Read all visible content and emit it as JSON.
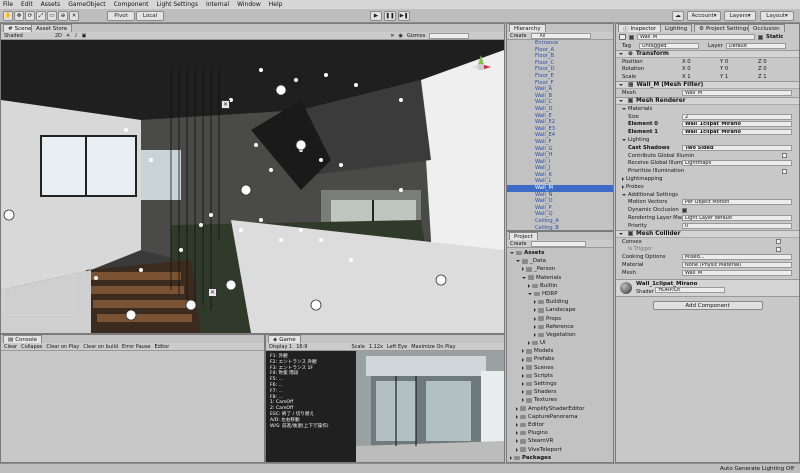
{
  "menu": [
    "File",
    "Edit",
    "Assets",
    "GameObject",
    "Component",
    "Light Settings",
    "Internal",
    "Window",
    "Help"
  ],
  "toolbar": {
    "pivot": "Pivot",
    "local": "Local",
    "account": "Account",
    "layers": "Layers",
    "layout": "Layout"
  },
  "scene": {
    "tab_scene": "Scene",
    "tab_asset_store": "Asset Store",
    "shaded": "Shaded",
    "mode_2d": "2D",
    "gizmos": "Gizmos"
  },
  "hierarchy": {
    "tab": "Hierarchy",
    "create": "Create",
    "search_all": "All",
    "items": [
      {
        "name": "Entrance",
        "blue": true
      },
      {
        "name": "Floor_A",
        "blue": true
      },
      {
        "name": "Floor_B",
        "blue": true
      },
      {
        "name": "Floor_C",
        "blue": true
      },
      {
        "name": "Floor_D",
        "blue": true
      },
      {
        "name": "Floor_E",
        "blue": true
      },
      {
        "name": "Floor_F",
        "blue": true
      },
      {
        "name": "Wall_A",
        "blue": true
      },
      {
        "name": "Wall_B",
        "blue": true
      },
      {
        "name": "Wall_C",
        "blue": true
      },
      {
        "name": "Wall_D",
        "blue": true
      },
      {
        "name": "Wall_E",
        "blue": true
      },
      {
        "name": "Wall_E2",
        "blue": true
      },
      {
        "name": "Wall_E3",
        "blue": true
      },
      {
        "name": "Wall_E4",
        "blue": true
      },
      {
        "name": "Wall_F",
        "blue": true
      },
      {
        "name": "Wall_G",
        "blue": true
      },
      {
        "name": "Wall_H",
        "blue": true
      },
      {
        "name": "Wall_I",
        "blue": true
      },
      {
        "name": "Wall_J",
        "blue": true
      },
      {
        "name": "Wall_K",
        "blue": true
      },
      {
        "name": "Wall_L",
        "blue": true
      },
      {
        "name": "Wall_M",
        "blue": false,
        "sel": true
      },
      {
        "name": "Wall_N",
        "blue": true
      },
      {
        "name": "Wall_O",
        "blue": true
      },
      {
        "name": "Wall_P",
        "blue": true
      },
      {
        "name": "Wall_Q",
        "blue": true
      },
      {
        "name": "Ceiling_A",
        "blue": true
      },
      {
        "name": "Ceiling_B",
        "blue": true
      }
    ]
  },
  "project": {
    "tab": "Project",
    "create": "Create",
    "items": [
      {
        "name": "Assets",
        "depth": 0,
        "open": true,
        "bold": true
      },
      {
        "name": "_Data",
        "depth": 1,
        "open": true
      },
      {
        "name": "_Person",
        "depth": 2
      },
      {
        "name": "Materials",
        "depth": 2,
        "open": true
      },
      {
        "name": "Builtin",
        "depth": 3
      },
      {
        "name": "HDRP",
        "depth": 3,
        "open": true
      },
      {
        "name": "Building",
        "depth": 4
      },
      {
        "name": "Landscape",
        "depth": 4
      },
      {
        "name": "Props",
        "depth": 4
      },
      {
        "name": "Reference",
        "depth": 4
      },
      {
        "name": "Vegetation",
        "depth": 4
      },
      {
        "name": "UI",
        "depth": 3
      },
      {
        "name": "Models",
        "depth": 2
      },
      {
        "name": "Prefabs",
        "depth": 2
      },
      {
        "name": "Scenes",
        "depth": 2
      },
      {
        "name": "Scripts",
        "depth": 2
      },
      {
        "name": "Settings",
        "depth": 2
      },
      {
        "name": "Shaders",
        "depth": 2
      },
      {
        "name": "Textures",
        "depth": 2
      },
      {
        "name": "AmplifyShaderEditor",
        "depth": 1
      },
      {
        "name": "CapturePanorama",
        "depth": 1
      },
      {
        "name": "Editor",
        "depth": 1
      },
      {
        "name": "Plugins",
        "depth": 1
      },
      {
        "name": "SteamVR",
        "depth": 1
      },
      {
        "name": "ViveTeleport",
        "depth": 1
      },
      {
        "name": "Packages",
        "depth": 0,
        "bold": true
      }
    ]
  },
  "inspector": {
    "tab_inspector": "Inspector",
    "tab_lighting": "Lighting",
    "tab_project_settings": "Project Settings",
    "tab_occlusion": "Occlusion",
    "object_name": "Wall_M",
    "static_label": "Static",
    "tag_label": "Tag",
    "tag_value": "Untagged",
    "layer_label": "Layer",
    "layer_value": "Default",
    "transform": {
      "title": "Transform",
      "position_label": "Position",
      "rotation_label": "Rotation",
      "scale_label": "Scale",
      "position": [
        "X 0",
        "Y 0",
        "Z 0"
      ],
      "rotation": [
        "X 0",
        "Y 0",
        "Z 0"
      ],
      "scale": [
        "X 1",
        "Y 1",
        "Z 1"
      ]
    },
    "mesh_filter": {
      "title": "Wall_M (Mesh Filter)",
      "mesh_label": "Mesh",
      "mesh_value": "Wall_M"
    },
    "mesh_renderer": {
      "title": "Mesh Renderer",
      "materials_label": "Materials",
      "size_label": "Size",
      "size_value": "2",
      "element0_label": "Element 0",
      "element0_value": "Wall_1clipat_Mirano",
      "element1_label": "Element 1",
      "element1_value": "Wall_1clipat_Mirano",
      "lighting_label": "Lighting",
      "cast_shadows_label": "Cast Shadows",
      "cast_shadows_value": "Two Sided",
      "contribute_gi_label": "Contribute Global Illumin",
      "receive_gi_label": "Receive Global Illuminati",
      "receive_gi_value": "Lightmaps",
      "prioritize_label": "Prioritize Illumination",
      "lightmapping_label": "Lightmapping",
      "probes_label": "Probes",
      "additional_label": "Additional Settings",
      "motion_vectors_label": "Motion Vectors",
      "motion_vectors_value": "Per Object Motion",
      "dynamic_occlusion_label": "Dynamic Occlusion",
      "rendering_layer_label": "Rendering Layer Mask",
      "rendering_layer_value": "Light Layer default",
      "priority_label": "Priority",
      "priority_value": "0"
    },
    "mesh_collider": {
      "title": "Mesh Collider",
      "convex_label": "Convex",
      "is_trigger_label": "Is Trigger",
      "cooking_label": "Cooking Options",
      "cooking_value": "Mixed...",
      "material_label": "Material",
      "material_value": "None (Physic Material)",
      "mesh_label": "Mesh",
      "mesh_value": "Wall_M"
    },
    "material_preview": {
      "name": "Wall_1clipat_Mirano",
      "shader_label": "Shader",
      "shader_value": "HDRP/Lit"
    },
    "add_component": "Add Component"
  },
  "console": {
    "tab": "Console",
    "clear": "Clear",
    "collapse": "Collapse",
    "clear_on_play": "Clear on Play",
    "clear_on_build": "Clear on build",
    "error_pause": "Error Pause",
    "editor": "Editor"
  },
  "game": {
    "tab": "Game",
    "display": "Display 1",
    "aspect": "16:9",
    "scale_label": "Scale",
    "scale_value": "1.12x",
    "eye": "Left Eye",
    "maximize": "Maximize On Play",
    "overlay_lines": [
      "F1: 外観",
      "F2: エントランス 外観",
      "F3: エントランス 1F",
      "F4: 吹抜 階段",
      "F5: ...",
      "F6: ...",
      "F7: ...",
      "F8: ...",
      "1: CamOff",
      "2: CamOff",
      "ESC: 終了 / 切り替え",
      "A/D: 左右移動",
      "W/S: 前進/後退(上下で操作)"
    ]
  },
  "status": {
    "text": "Auto Generate Lighting Off"
  }
}
